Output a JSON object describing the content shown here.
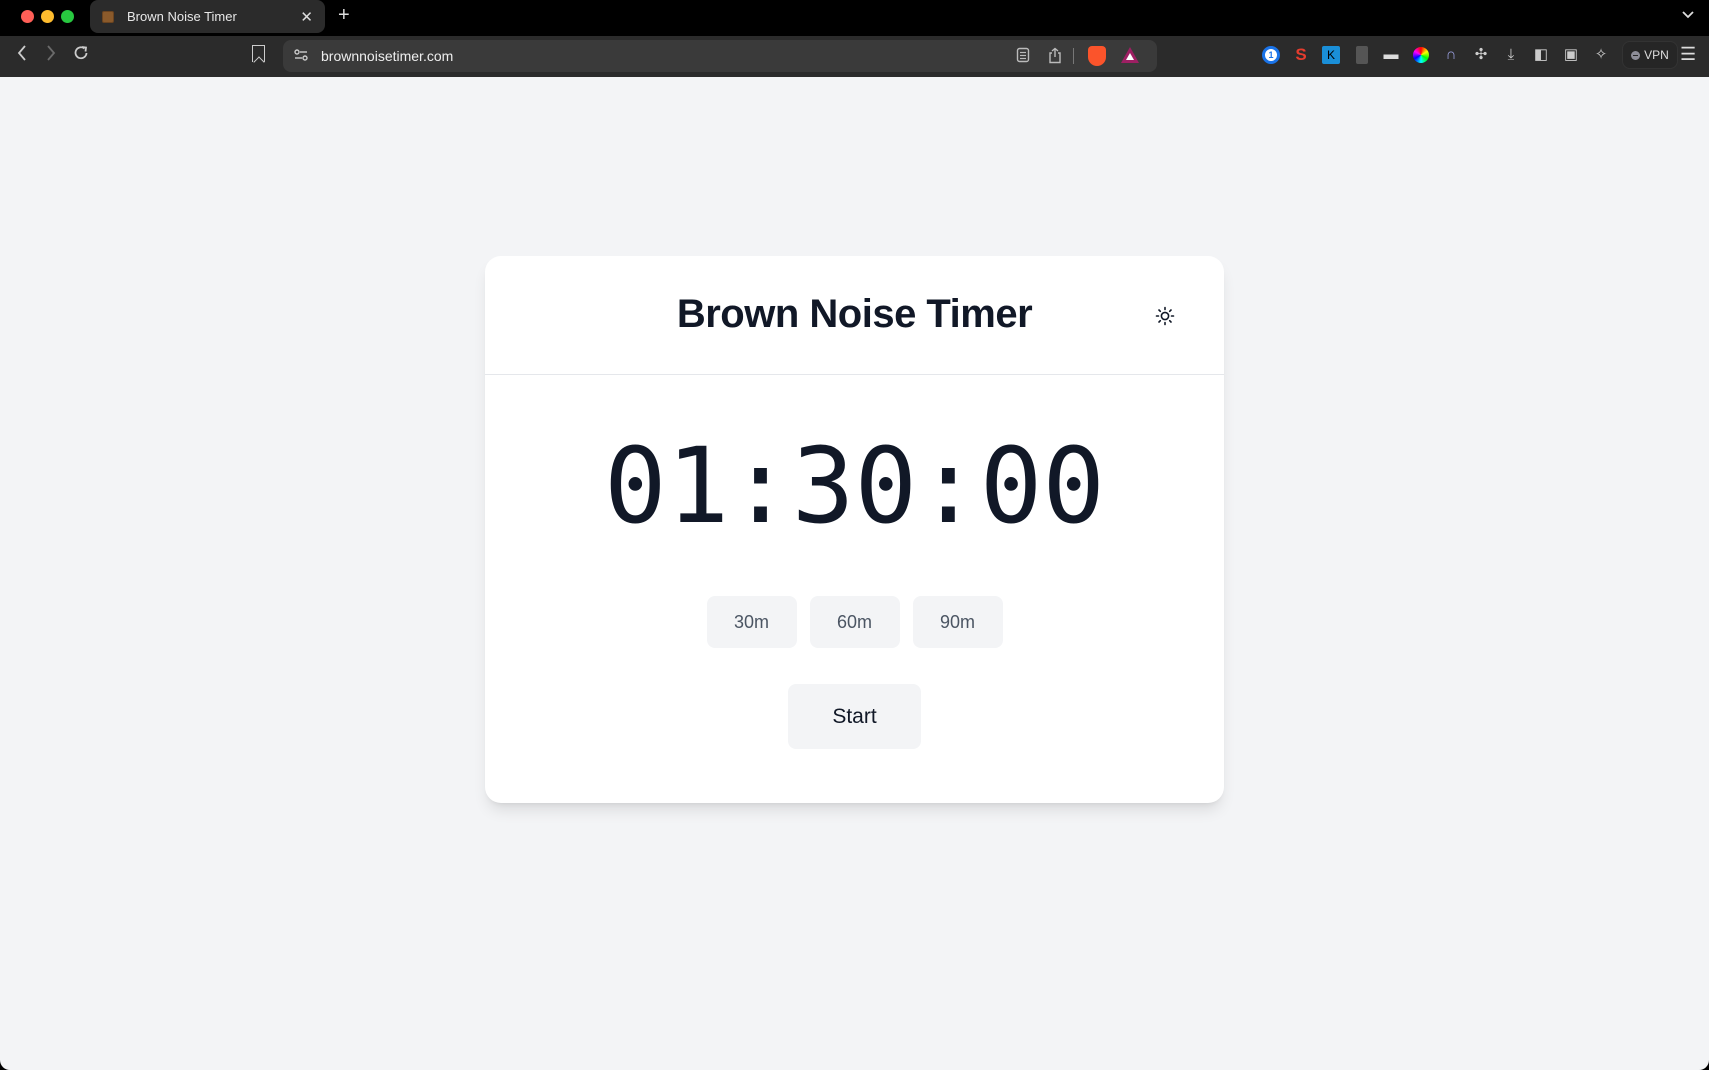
{
  "browser": {
    "tab": {
      "title": "Brown Noise Timer",
      "favicon": "brown-square-favicon",
      "close_glyph": "✕"
    },
    "new_tab_glyph": "+",
    "tab_list_glyph": "⌄",
    "nav": {
      "back": "‹",
      "forward": "›",
      "reload": "↻"
    },
    "url": "brownnoisetimer.com",
    "site_settings_glyph": "⚲",
    "reader_glyph": "▤",
    "share_glyph": "⇧",
    "extensions": [
      {
        "name": "1password",
        "glyph": "1"
      },
      {
        "name": "seo",
        "glyph": "S"
      },
      {
        "name": "kindle",
        "glyph": "K"
      },
      {
        "name": "document",
        "glyph": ""
      },
      {
        "name": "printer",
        "glyph": "▬"
      },
      {
        "name": "color-picker",
        "glyph": ""
      },
      {
        "name": "headphones",
        "glyph": "∩"
      },
      {
        "name": "extensions-puzzle",
        "glyph": "✣"
      },
      {
        "name": "downloads",
        "glyph": "⤓"
      },
      {
        "name": "sidebar",
        "glyph": "◧"
      },
      {
        "name": "wallet",
        "glyph": "▣"
      },
      {
        "name": "leo-ai",
        "glyph": "✧"
      }
    ],
    "vpn_label": "VPN",
    "menu_glyph": "☰"
  },
  "page": {
    "title": "Brown Noise Timer",
    "theme_toggle": "light-mode-sun",
    "timer": "01:30:00",
    "presets": [
      {
        "label": "30m",
        "minutes": 30
      },
      {
        "label": "60m",
        "minutes": 60
      },
      {
        "label": "90m",
        "minutes": 90
      }
    ],
    "start_label": "Start"
  },
  "colors": {
    "page_bg": "#f3f4f6",
    "card_bg": "#ffffff",
    "text_primary": "#111827",
    "text_secondary": "#4b5563",
    "button_bg": "#f3f4f6"
  }
}
